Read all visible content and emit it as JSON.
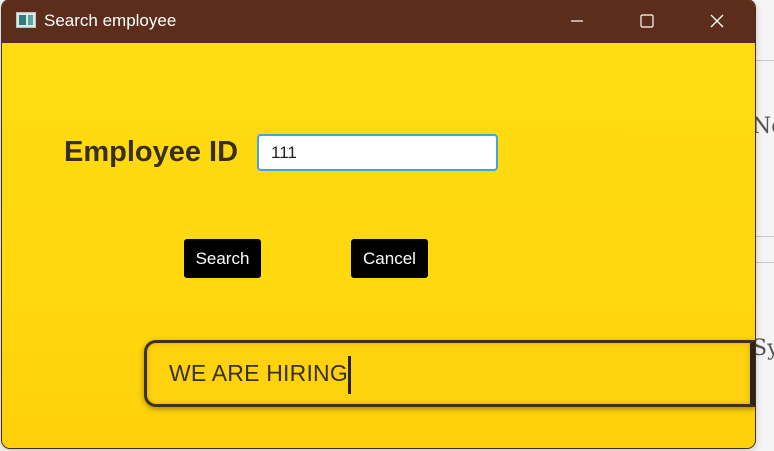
{
  "window": {
    "title": "Search employee",
    "accent_color": "#ffd811",
    "titlebar_color": "#5c2d1a",
    "controls": {
      "minimize_icon": "minimize-icon",
      "maximize_icon": "maximize-icon",
      "close_icon": "close-icon"
    }
  },
  "form": {
    "employee_id_label": "Employee ID",
    "employee_id_value": "111",
    "search_label": "Search",
    "cancel_label": "Cancel"
  },
  "banner": {
    "text": "WE ARE HIRING"
  },
  "background_app": {
    "right_fragment_1": "No",
    "right_fragment_2": "Sys"
  }
}
